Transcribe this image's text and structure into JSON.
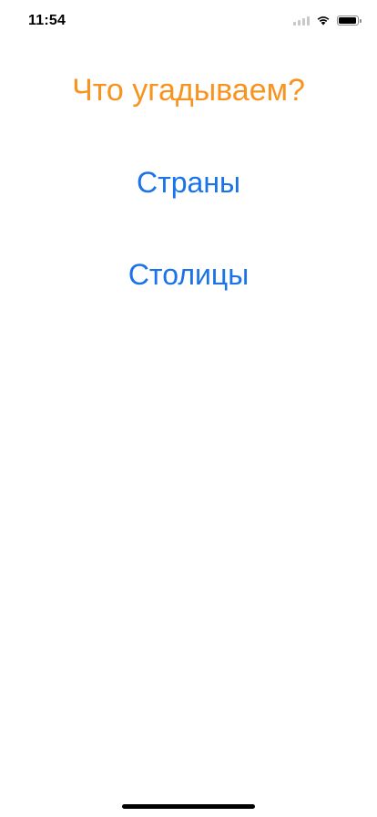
{
  "status_bar": {
    "time": "11:54",
    "battery_level": 0.95,
    "icons": [
      "cellular-signal-icon",
      "wifi-icon",
      "battery-icon"
    ]
  },
  "screen": {
    "title": "Что угадываем?",
    "options": [
      {
        "label": "Страны"
      },
      {
        "label": "Столицы"
      }
    ]
  },
  "colors": {
    "title": "#f7931e",
    "buttons": "#1a73e8",
    "background": "#ffffff"
  }
}
